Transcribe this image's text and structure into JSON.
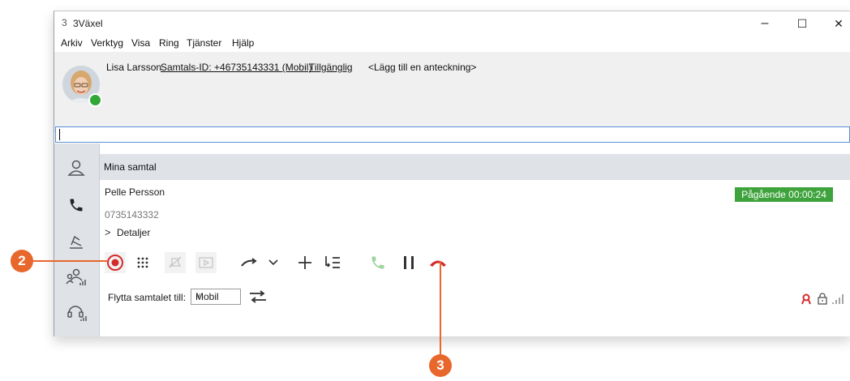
{
  "window": {
    "title": "3Växel",
    "logo": "3",
    "controls": {
      "minimize": "–",
      "maximize": "☐",
      "close": "✕"
    }
  },
  "menu": [
    "Arkiv",
    "Verktyg",
    "Visa",
    "Ring",
    "Tjänster",
    "Hjälp"
  ],
  "profile": {
    "name": "Lisa Larsson",
    "caller_id": "Samtals-ID: +46735143331 (Mobil)",
    "status": "Tillgänglig",
    "note_placeholder": "<Lägg till en anteckning>",
    "presence_color": "#30a836"
  },
  "search": {
    "value": ""
  },
  "sidebar": {
    "items": [
      "contacts-icon",
      "phone-icon",
      "switchboard-icon",
      "groups-icon",
      "headset-icon"
    ]
  },
  "calls": {
    "section_title": "Mina samtal",
    "caller_name": "Pelle Persson",
    "caller_number": "0735143332",
    "details_label": "Detaljer",
    "status_text": "Pågående 00:00:24",
    "status_color": "#3ea33c",
    "move_label": "Flytta samtalet till:",
    "move_option": "Mobil"
  },
  "callouts": {
    "record": "2",
    "hangup": "3",
    "color": "#e8672c"
  }
}
